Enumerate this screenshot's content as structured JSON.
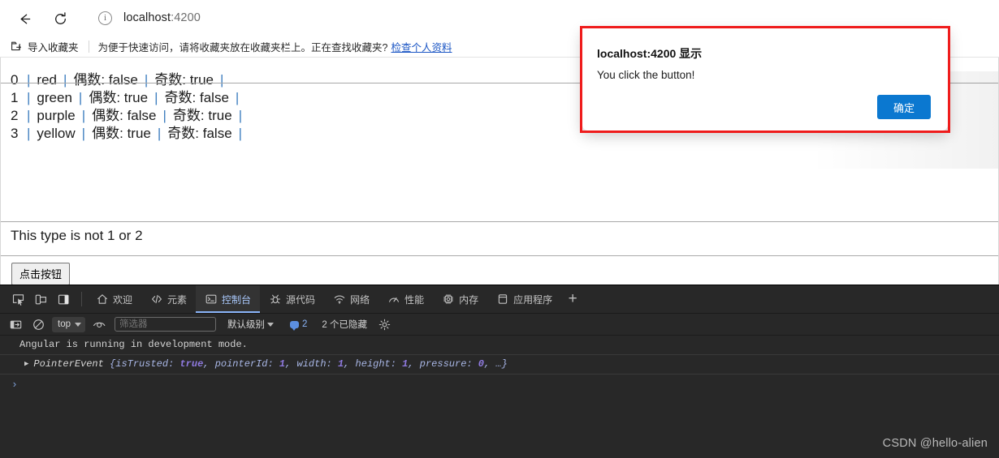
{
  "browser": {
    "back_label": "Back",
    "reload_label": "Reload",
    "url_host": "localhost",
    "url_port": ":4200",
    "info_glyph": "i"
  },
  "bookmarks": {
    "import_label": "导入收藏夹",
    "message": "为便于快速访问，请将收藏夹放在收藏夹栏上。正在查找收藏夹?",
    "link_label": "检查个人资料"
  },
  "page": {
    "rows": [
      {
        "index": "0",
        "color": "red",
        "even_label": "偶数:",
        "even_value": "false",
        "odd_label": "奇数:",
        "odd_value": "true"
      },
      {
        "index": "1",
        "color": "green",
        "even_label": "偶数:",
        "even_value": "true",
        "odd_label": "奇数:",
        "odd_value": "false"
      },
      {
        "index": "2",
        "color": "purple",
        "even_label": "偶数:",
        "even_value": "false",
        "odd_label": "奇数:",
        "odd_value": "true"
      },
      {
        "index": "3",
        "color": "yellow",
        "even_label": "偶数:",
        "even_value": "true",
        "odd_label": "奇数:",
        "odd_value": "false"
      }
    ],
    "type_text": "This type is not 1 or 2",
    "button_label": "点击按钮",
    "separator": "|"
  },
  "dialog": {
    "title": "localhost:4200 显示",
    "message": "You click the button!",
    "ok_label": "确定",
    "highlight_color": "#ef1c1c",
    "ok_color": "#0b78d0"
  },
  "devtools": {
    "left_icons": [
      {
        "name": "inspect-element-icon",
        "label": "检查"
      },
      {
        "name": "device-toolbar-icon",
        "label": "设备工具栏"
      },
      {
        "name": "dock-side-icon",
        "label": "停靠位置"
      }
    ],
    "tabs": [
      {
        "label": "欢迎",
        "icon": "home-icon",
        "active": false
      },
      {
        "label": "元素",
        "icon": "code-icon",
        "active": false
      },
      {
        "label": "控制台",
        "icon": "console-icon",
        "active": true
      },
      {
        "label": "源代码",
        "icon": "sources-icon",
        "active": false
      },
      {
        "label": "网络",
        "icon": "network-icon",
        "active": false
      },
      {
        "label": "性能",
        "icon": "performance-icon",
        "active": false
      },
      {
        "label": "内存",
        "icon": "memory-icon",
        "active": false
      },
      {
        "label": "应用程序",
        "icon": "application-icon",
        "active": false
      }
    ],
    "more_tabs_label": "+",
    "filterbar": {
      "sidebar_toggle": "console-sidebar-icon",
      "clear_label": "清除控制台",
      "context": "top",
      "eye_label": "实时表达式",
      "filter_placeholder": "筛选器",
      "filter_value": "",
      "level_label": "默认级别",
      "issues_count": "2",
      "hidden_label": "2 个已隐藏",
      "settings_label": "控制台设置"
    },
    "console": {
      "messages": [
        {
          "type": "log",
          "text": "Angular is running in development mode."
        }
      ],
      "object_line": {
        "class_name": "PointerEvent",
        "open_brace": "{",
        "props": [
          {
            "key": "isTrusted",
            "value": "true"
          },
          {
            "key": "pointerId",
            "value": "1"
          },
          {
            "key": "width",
            "value": "1"
          },
          {
            "key": "height",
            "value": "1"
          },
          {
            "key": "pressure",
            "value": "0"
          }
        ],
        "ellipsis": "…",
        "close_brace": "}"
      },
      "prompt_symbol": "›"
    }
  },
  "watermark": "CSDN @hello-alien"
}
